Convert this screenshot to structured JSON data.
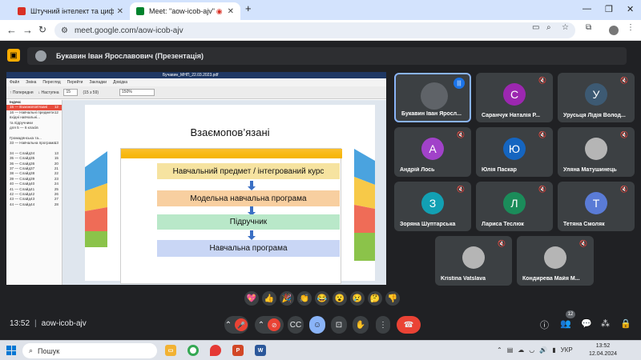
{
  "browser": {
    "tabs": [
      {
        "title": "Штучний інтелект та цифрові",
        "active": false
      },
      {
        "title": "Meet: \"aow-icob-ajv\"",
        "active": true
      }
    ],
    "new_tab": "+",
    "url": "meet.google.com/aow-icob-ajv"
  },
  "meet": {
    "presenter_chip": "Букавин Іван Ярославович (Презентація)",
    "shared_screen": {
      "window_title": "Бучавин_МНП_22.03.2023.pdf",
      "menu": [
        "Файл",
        "Зміна",
        "Перегляд",
        "Перейти",
        "Закладки",
        "Довідка"
      ],
      "toolbar": {
        "prev": "Попередня",
        "next": "Наступна",
        "page": "15",
        "page_of": "(15 з 59)",
        "zoom": "150%"
      },
      "sidebar_title": "Індекс",
      "sidebar_items": [
        {
          "label": "15 — Взаємопов'язані",
          "page": "12",
          "selected": true
        },
        {
          "label": "16 — Навчальні предмети",
          "page": "12"
        },
        {
          "label": "вхідні навчальні...",
          "page": ""
        },
        {
          "label": "та підручники",
          "page": ""
        },
        {
          "label": "для 5 — 6 класів",
          "page": ""
        },
        {
          "label": "",
          "page": ""
        },
        {
          "label": "Громадянська та...",
          "page": ""
        },
        {
          "label": "33 — Навчальна програма",
          "page": "13"
        },
        {
          "label": "",
          "page": ""
        },
        {
          "label": "34 — Слайд34",
          "page": "13"
        },
        {
          "label": "35 — Слайд35",
          "page": "15"
        },
        {
          "label": "36 — Слайд36",
          "page": "20"
        },
        {
          "label": "37 — Слайд37",
          "page": "21"
        },
        {
          "label": "38 — Слайд38",
          "page": "22"
        },
        {
          "label": "39 — Слайд39",
          "page": "23"
        },
        {
          "label": "40 — Слайд40",
          "page": "24"
        },
        {
          "label": "41 — Слайд41",
          "page": "25"
        },
        {
          "label": "42 — Слайд42",
          "page": "26"
        },
        {
          "label": "43 — Слайд43",
          "page": "27"
        },
        {
          "label": "44 — Слайд44",
          "page": "28"
        }
      ],
      "slide": {
        "title": "Взаємопов’язані",
        "boxes": [
          "Навчальний предмет / інтегрований курс",
          "Модельна навчальна програма",
          "Підручник",
          "Навчальна програма"
        ]
      }
    },
    "participants": [
      {
        "name": "Букавин Іван Яросл...",
        "initial": "",
        "color": "#5f6368",
        "speaking": true
      },
      {
        "name": "Саранчук Наталія Р...",
        "initial": "С",
        "color": "#9c27b0"
      },
      {
        "name": "Урусьця Лідія Волод...",
        "initial": "У",
        "color": "#3d5a73"
      },
      {
        "name": "Андрій Лось",
        "initial": "А",
        "color": "#a142c9"
      },
      {
        "name": "Юлія Паскар",
        "initial": "Ю",
        "color": "#1565c0"
      },
      {
        "name": "Уляна Матушинець",
        "initial": "",
        "color": "#b5b5b5"
      },
      {
        "name": "Зоряна Шуптарська",
        "initial": "З",
        "color": "#12a0b3"
      },
      {
        "name": "Лариса Теслюк",
        "initial": "Л",
        "color": "#1b8c5a"
      },
      {
        "name": "Тетяна Смоляк",
        "initial": "Т",
        "color": "#5a7bd6"
      },
      {
        "name": "Kristina Vatslava",
        "initial": "",
        "color": "#b5b5b5"
      },
      {
        "name": "Кондирева Майя М...",
        "initial": "",
        "color": "#b5b5b5"
      }
    ],
    "reactions": [
      "💖",
      "👍",
      "🎉",
      "👏",
      "😂",
      "😮",
      "😢",
      "🤔",
      "👎"
    ],
    "time": "13:52",
    "meeting_code": "aow-icob-ajv",
    "people_count": "12"
  },
  "taskbar": {
    "search_placeholder": "Пошук",
    "language": "УКР",
    "clock_time": "13:52",
    "clock_date": "12.04.2024"
  },
  "colors": {
    "meet_bg": "#202124",
    "tile_bg": "#3c4043",
    "end_call": "#ea4335",
    "accent": "#8ab4f8"
  }
}
